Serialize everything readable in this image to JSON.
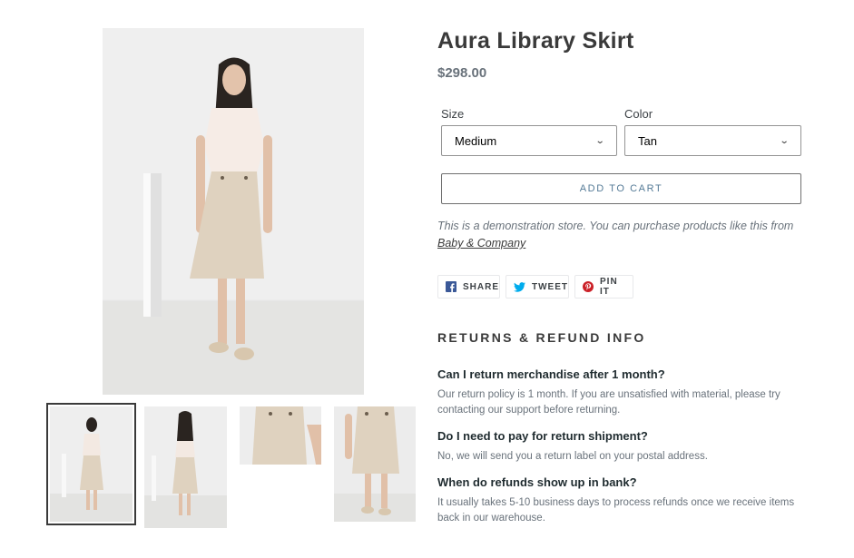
{
  "product": {
    "title": "Aura Library Skirt",
    "price": "$298.00"
  },
  "options": {
    "size_label": "Size",
    "size_value": "Medium",
    "color_label": "Color",
    "color_value": "Tan"
  },
  "cart": {
    "add_label": "ADD TO CART"
  },
  "demo_notice": {
    "text": "This is a demonstration store. You can purchase products like this from",
    "link": "Baby & Company"
  },
  "share": {
    "facebook": "SHARE",
    "twitter": "TWEET",
    "pinterest": "PIN IT"
  },
  "returns": {
    "heading": "RETURNS & REFUND INFO",
    "faq": [
      {
        "question": "Can I return merchandise after 1 month?",
        "answer": "Our return policy is 1 month. If you are unsatisfied with material, please try contacting our support before returning."
      },
      {
        "question": "Do I need to pay for return shipment?",
        "answer": "No, we will send you a return label on your postal address."
      },
      {
        "question": "When do refunds show up in bank?",
        "answer": "It usually takes 5-10 business days to process refunds once we receive items back in our warehouse."
      }
    ]
  },
  "colors": {
    "facebook": "#3b5998",
    "twitter": "#00aced",
    "pinterest": "#cb2027",
    "accent": "#557b97",
    "skirt": "#dfd2bf"
  },
  "icons": [
    "chevron-down-icon",
    "facebook-icon",
    "twitter-icon",
    "pinterest-icon"
  ]
}
